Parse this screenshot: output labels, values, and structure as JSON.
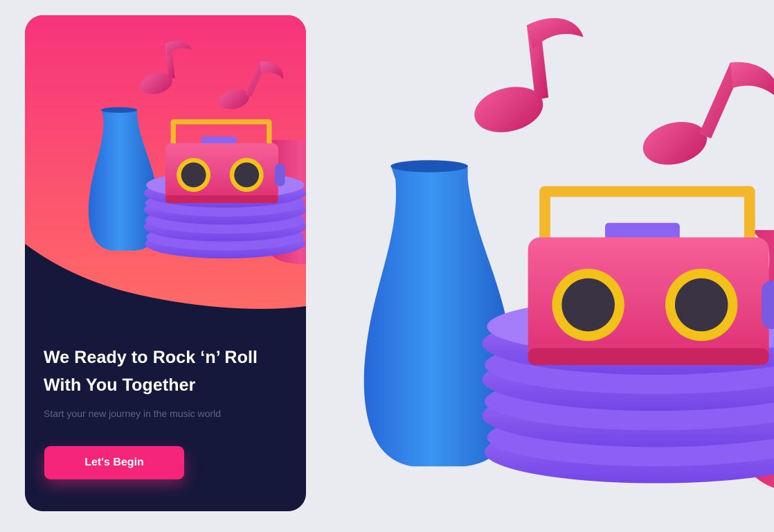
{
  "onboarding": {
    "title_line1": "We Ready to Rock ‘n’ Roll",
    "title_line2": "With You Together",
    "subtitle": "Start your new journey in the music world",
    "cta_label": "Let's Begin"
  },
  "colors": {
    "accent": "#f5267a",
    "card_background": "#15183a",
    "hero_gradient_top": "#f7337c",
    "hero_gradient_bottom": "#ff6a66",
    "page_background": "#eaebf0",
    "vase_blue": "#2f7fe6",
    "vase_pink": "#e8307c",
    "radio_body": "#f04a8a",
    "speaker_ring": "#f3c21a",
    "pedestal": "#8a5cf2"
  },
  "icons": [
    "music-note-icon",
    "music-note-icon"
  ]
}
